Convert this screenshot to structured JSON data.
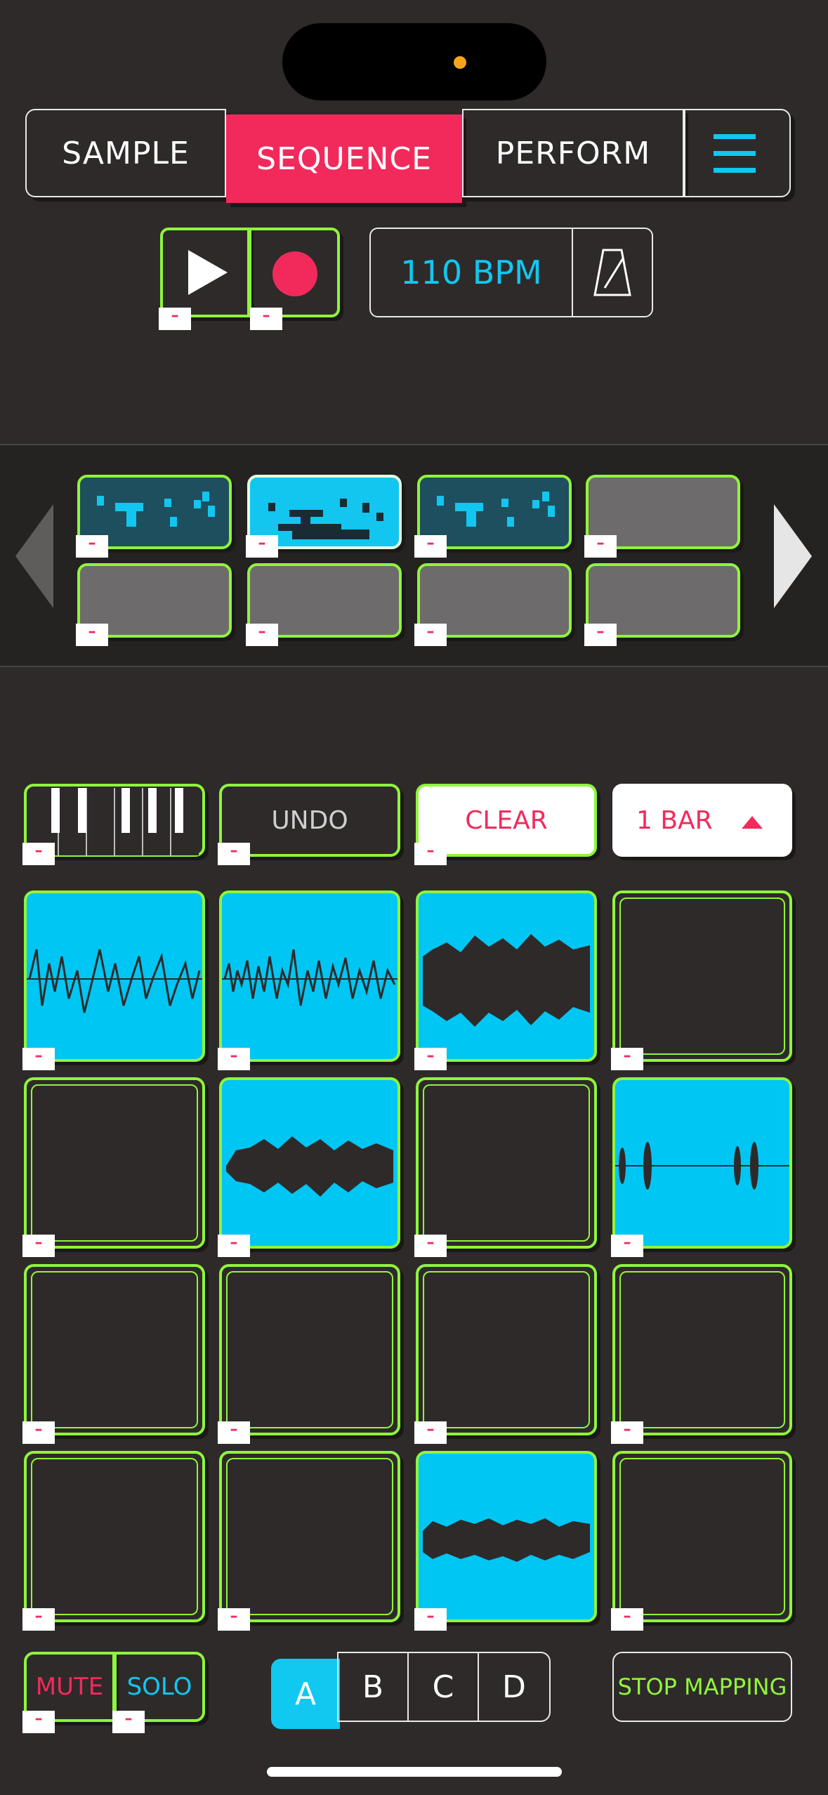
{
  "nav": {
    "tabs": [
      "SAMPLE",
      "SEQUENCE",
      "PERFORM"
    ],
    "active_tab": "SEQUENCE",
    "menu_icon": "hamburger-icon"
  },
  "transport": {
    "play_icon": "play-icon",
    "record_icon": "record-icon",
    "bpm_label": "110 BPM",
    "metronome_icon": "metronome-icon"
  },
  "patterns": {
    "left_arrow_icon": "arrow-left-icon",
    "right_arrow_icon": "arrow-right-icon",
    "states": [
      "filled",
      "active",
      "filled",
      "empty",
      "empty",
      "empty",
      "empty",
      "empty"
    ]
  },
  "tools": {
    "keyboard_icon": "piano-keys-icon",
    "undo_label": "UNDO",
    "clear_label": "CLEAR",
    "bar_label": "1 BAR",
    "bar_caret_icon": "caret-up-icon"
  },
  "pads": {
    "states": [
      "filled",
      "filled",
      "filled",
      "empty",
      "empty",
      "filled",
      "empty",
      "filled",
      "empty",
      "empty",
      "empty",
      "empty",
      "empty",
      "empty",
      "filled",
      "empty"
    ],
    "minus_label": "–"
  },
  "bottom": {
    "mute_label": "MUTE",
    "solo_label": "SOLO",
    "banks": [
      "A",
      "B",
      "C",
      "D"
    ],
    "active_bank": "A",
    "stop_mapping_label": "STOP MAPPING"
  },
  "colors": {
    "accent_pink": "#f22a5c",
    "accent_cyan": "#10c8f0",
    "accent_green": "#8ff53a",
    "background": "#2e2a2a"
  }
}
